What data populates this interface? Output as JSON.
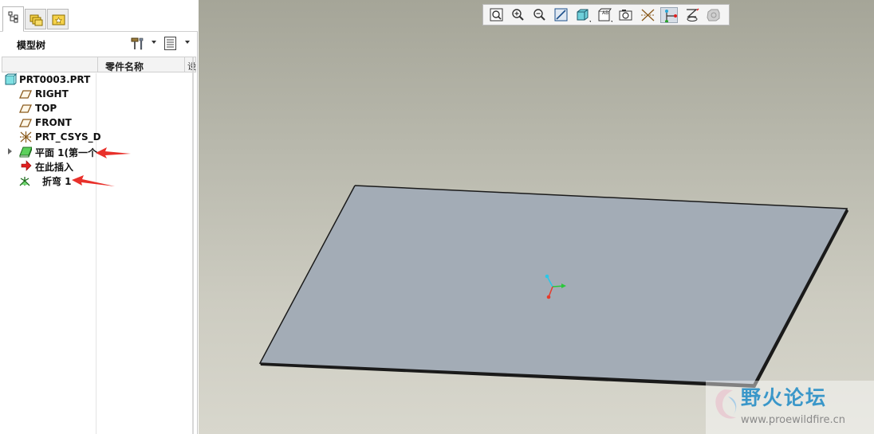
{
  "panel": {
    "tabs": [
      {
        "name": "model-tree-tab-icon",
        "active": true
      },
      {
        "name": "folder-browser-tab-icon",
        "active": false
      },
      {
        "name": "favorites-tab-icon",
        "active": false
      }
    ],
    "title": "模型树",
    "columns": {
      "name": "零件名称",
      "extra": "设"
    }
  },
  "tree": {
    "items": [
      {
        "label": "PRT0003.PRT",
        "icon": "part-icon"
      },
      {
        "label": "RIGHT",
        "icon": "datum-plane-icon"
      },
      {
        "label": "TOP",
        "icon": "datum-plane-icon"
      },
      {
        "label": "FRONT",
        "icon": "datum-plane-icon"
      },
      {
        "label": "PRT_CSYS_D",
        "icon": "coordinate-system-icon"
      },
      {
        "label": "平面 1(第一个",
        "icon": "flat-wall-icon"
      },
      {
        "label": "在此插入",
        "icon": "insert-here-arrow-icon"
      },
      {
        "label": "折弯 1",
        "icon": "bend-feature-icon"
      }
    ]
  },
  "viewport": {
    "toolbar": [
      "refit-icon",
      "zoom-in-icon",
      "zoom-out-icon",
      "repaint-icon",
      "display-style-icon",
      "saved-views-icon",
      "named-view-icon",
      "datum-planes-toggle-icon",
      "datum-axes-toggle-icon",
      "datum-points-toggle-icon",
      "csys-toggle-icon",
      "annotations-toggle-icon"
    ],
    "colors": {
      "sheet": "#a3acb6",
      "edge": "#1a1a1a",
      "background_top": "#a5a598",
      "background_bottom": "#d8d7cd",
      "arrow": "#e8302a"
    }
  },
  "watermark": {
    "title": "野火论坛",
    "url": "www.proewildfire.cn"
  }
}
